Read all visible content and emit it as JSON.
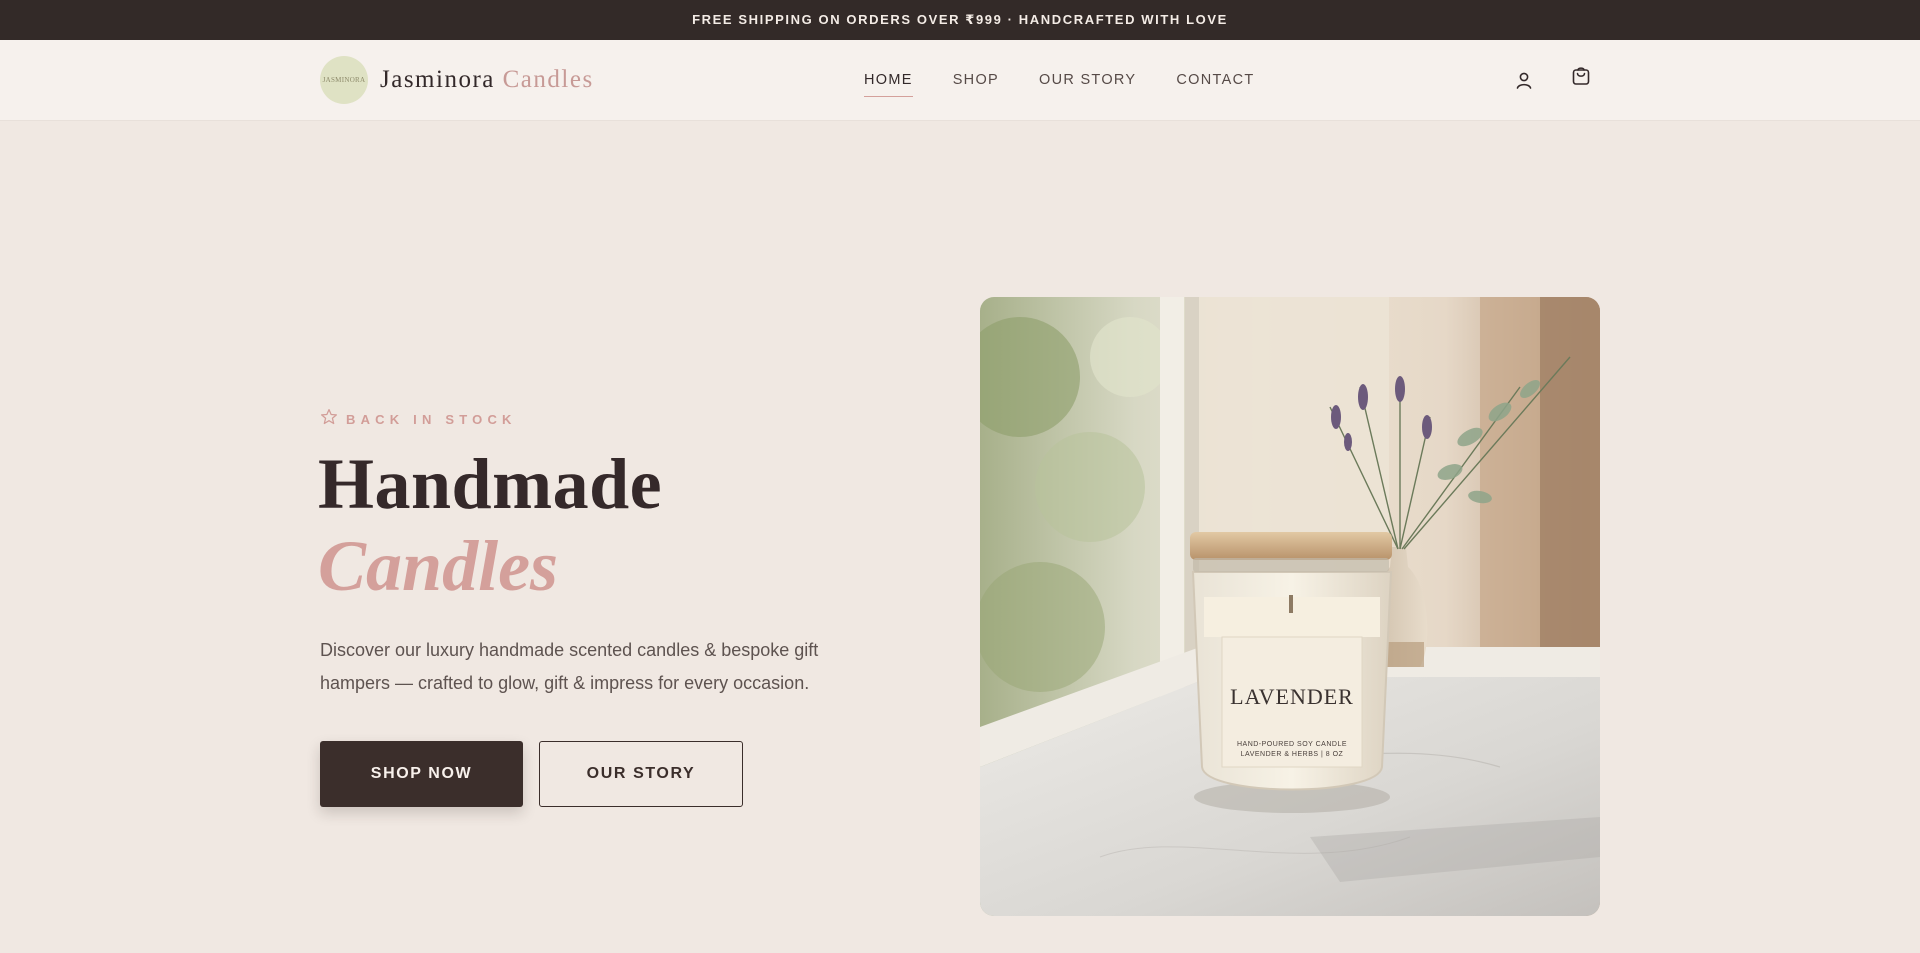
{
  "announcement": {
    "text": "FREE SHIPPING ON ORDERS OVER ₹999 · HANDCRAFTED WITH LOVE"
  },
  "header": {
    "logo_badge_text": "JASMINORA",
    "brand_name": "Jasminora",
    "brand_accent": "Candles",
    "nav": [
      {
        "label": "HOME",
        "active": true
      },
      {
        "label": "SHOP",
        "active": false
      },
      {
        "label": "OUR STORY",
        "active": false
      },
      {
        "label": "CONTACT",
        "active": false
      }
    ],
    "icons": [
      "user-icon",
      "shopping-bag-icon"
    ]
  },
  "hero": {
    "badge": "BACK IN STOCK",
    "title_line1": "Handmade",
    "title_line2": "Candles",
    "description": "Discover our luxury handmade scented candles & bespoke gift hampers — crafted to glow, gift & impress for every occasion.",
    "primary_cta": "SHOP NOW",
    "secondary_cta": "OUR STORY",
    "image": {
      "label_main": "LAVENDER",
      "label_sub1": "HAND-POURED SOY CANDLE",
      "label_sub2": "LAVENDER & HERBS | 8 OZ"
    }
  },
  "colors": {
    "announcement_bg": "#332a28",
    "page_bg": "#f0e8e2",
    "header_bg": "#f6f1ed",
    "accent_pink": "#d4a09b",
    "dark_brown": "#3b2e2b"
  }
}
